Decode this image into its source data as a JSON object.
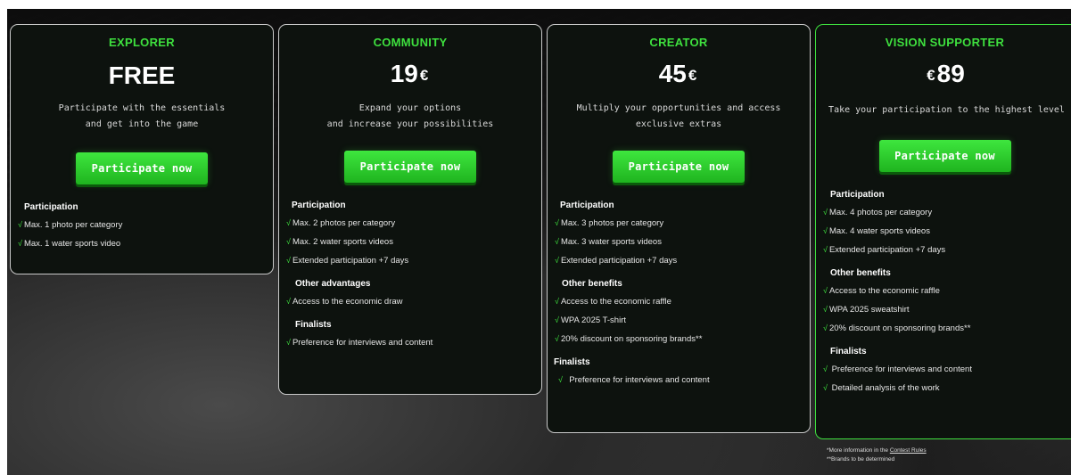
{
  "plans": [
    {
      "tier": "EXPLORER",
      "price": "FREE",
      "currency": "",
      "currency_position": "none",
      "description": "Participate with the essentials\nand get into the game",
      "cta": "Participate now",
      "sections": [
        {
          "title": "Participation",
          "items": [
            "Max. 1 photo per category",
            "Max. 1 water sports video"
          ]
        }
      ]
    },
    {
      "tier": "COMMUNITY",
      "price": "19",
      "currency": "€",
      "currency_position": "after",
      "description": "Expand your options\nand increase your possibilities",
      "cta": "Participate now",
      "sections": [
        {
          "title": "Participation",
          "items": [
            "Max. 2 photos per category",
            "Max. 2 water sports videos",
            "Extended participation +7 days"
          ]
        },
        {
          "title": "Other advantages",
          "items": [
            "Access to the economic draw"
          ]
        },
        {
          "title": "Finalists",
          "items": [
            "Preference for interviews and content"
          ]
        }
      ]
    },
    {
      "tier": "CREATOR",
      "price": "45",
      "currency": "€",
      "currency_position": "after",
      "description": "Multiply your opportunities and  access\nexclusive extras",
      "cta": "Participate now",
      "sections": [
        {
          "title": "Participation",
          "items": [
            "Max. 3 photos per category",
            "Max. 3 water sports videos",
            "Extended participation +7 days"
          ]
        },
        {
          "title": "Other benefits",
          "items": [
            "Access to the economic raffle",
            "WPA 2025 T-shirt",
            "20% discount on sponsoring brands**"
          ]
        },
        {
          "title": "Finalists",
          "items": [
            "Preference for interviews and content"
          ]
        }
      ]
    },
    {
      "tier": "VISION SUPPORTER",
      "price": "89",
      "currency": "€",
      "currency_position": "before",
      "description": "Take your participation  to the highest level",
      "cta": "Participate now",
      "sections": [
        {
          "title": "Participation",
          "items": [
            "Max. 4 photos per category",
            "Max. 4 water sports videos",
            "Extended participation +7 days"
          ]
        },
        {
          "title": "Other benefits",
          "items": [
            "Access to the economic raffle",
            "WPA 2025 sweatshirt",
            "20% discount on sponsoring brands**"
          ]
        },
        {
          "title": "Finalists",
          "items": [
            "Preference for interviews and content",
            "Detailed analysis of the work"
          ]
        }
      ]
    }
  ],
  "check_symbol": "√",
  "footnotes": {
    "line1_prefix": "*More information in the ",
    "line1_link": "Contest Rules",
    "line2": "**Brands to be determined"
  },
  "colors": {
    "accent": "#3ee03e",
    "card_bg": "#0d120e",
    "card_border": "#c9c9c9"
  }
}
